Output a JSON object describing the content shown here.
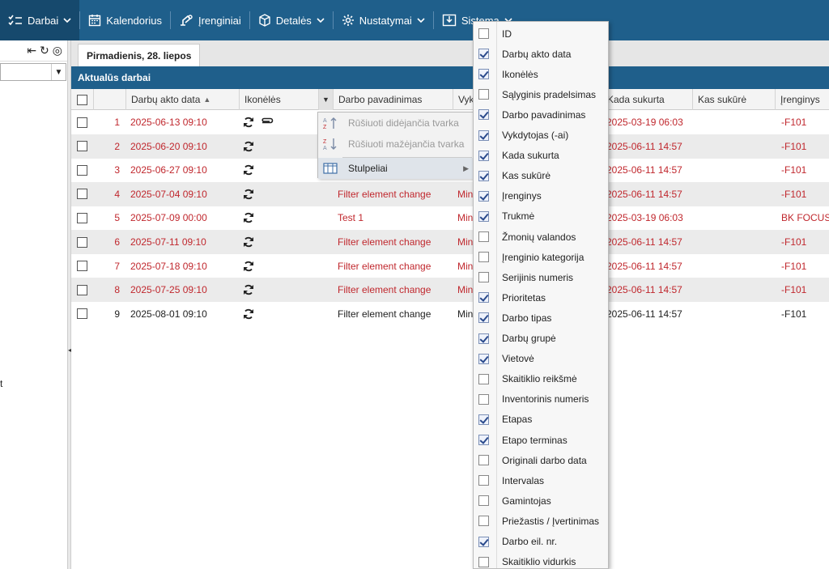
{
  "nav": {
    "items": [
      {
        "label": "Darbai",
        "icon": "checklist-icon",
        "dropdown": true,
        "active": true
      },
      {
        "label": "Kalendorius",
        "icon": "calendar-icon",
        "dropdown": false
      },
      {
        "label": "Įrenginiai",
        "icon": "device-icon",
        "dropdown": false
      },
      {
        "label": "Detalės",
        "icon": "box-icon",
        "dropdown": true
      },
      {
        "label": "Nustatymai",
        "icon": "gear-icon",
        "dropdown": true
      },
      {
        "label": "Sistema",
        "icon": "download-icon",
        "dropdown": true
      }
    ]
  },
  "left_panel": {
    "trailing_text": "t"
  },
  "day_tab": "Pirmadienis, 28. liepos",
  "panel_title": "Aktualūs darbai",
  "columns": [
    "Darbų akto data",
    "Ikonėlės",
    "Darbo pavadinimas",
    "Vyk",
    "Kada sukurta",
    "Kas sukūrė",
    "Įrenginys"
  ],
  "rows": [
    {
      "n": "1",
      "date": "2025-06-13 09:10",
      "icons": [
        "refresh-icon",
        "paperclip-icon"
      ],
      "name": "",
      "vyk": "",
      "created": "2025-03-19 06:03",
      "by": "",
      "device": "-F101",
      "red": true
    },
    {
      "n": "2",
      "date": "2025-06-20 09:10",
      "icons": [
        "refresh-icon"
      ],
      "name": "",
      "vyk": "",
      "created": "2025-06-11 14:57",
      "by": "",
      "device": "-F101",
      "red": true
    },
    {
      "n": "3",
      "date": "2025-06-27 09:10",
      "icons": [
        "refresh-icon"
      ],
      "name": "",
      "vyk": "",
      "created": "2025-06-11 14:57",
      "by": "",
      "device": "-F101",
      "red": true
    },
    {
      "n": "4",
      "date": "2025-07-04 09:10",
      "icons": [
        "refresh-icon"
      ],
      "name": "Filter element change",
      "vyk": "Min",
      "created": "2025-06-11 14:57",
      "by": "",
      "device": "-F101",
      "red": true
    },
    {
      "n": "5",
      "date": "2025-07-09 00:00",
      "icons": [
        "refresh-icon"
      ],
      "name": "Test 1",
      "vyk": "Min",
      "created": "2025-03-19 06:03",
      "by": "",
      "device": "BK FOCUS",
      "red": true
    },
    {
      "n": "6",
      "date": "2025-07-11 09:10",
      "icons": [
        "refresh-icon"
      ],
      "name": "Filter element change",
      "vyk": "Min",
      "created": "2025-06-11 14:57",
      "by": "",
      "device": "-F101",
      "red": true
    },
    {
      "n": "7",
      "date": "2025-07-18 09:10",
      "icons": [
        "refresh-icon"
      ],
      "name": "Filter element change",
      "vyk": "Min",
      "created": "2025-06-11 14:57",
      "by": "",
      "device": "-F101",
      "red": true
    },
    {
      "n": "8",
      "date": "2025-07-25 09:10",
      "icons": [
        "refresh-icon"
      ],
      "name": "Filter element change",
      "vyk": "Min",
      "created": "2025-06-11 14:57",
      "by": "",
      "device": "-F101",
      "red": true
    },
    {
      "n": "9",
      "date": "2025-08-01 09:10",
      "icons": [
        "refresh-icon"
      ],
      "name": "Filter element change",
      "vyk": "Min",
      "created": "2025-06-11 14:57",
      "by": "",
      "device": "-F101",
      "red": false
    }
  ],
  "context_menu": {
    "sort_asc": "Rūšiuoti didėjančia tvarka",
    "sort_desc": "Rūšiuoti mažėjančia tvarka",
    "columns": "Stulpeliai"
  },
  "column_menu": [
    {
      "label": "ID",
      "checked": false
    },
    {
      "label": "Darbų akto data",
      "checked": true
    },
    {
      "label": "Ikonėlės",
      "checked": true
    },
    {
      "label": "Sąlyginis pradelsimas",
      "checked": false
    },
    {
      "label": "Darbo pavadinimas",
      "checked": true
    },
    {
      "label": "Vykdytojas (-ai)",
      "checked": true
    },
    {
      "label": "Kada sukurta",
      "checked": true
    },
    {
      "label": "Kas sukūrė",
      "checked": true
    },
    {
      "label": "Įrenginys",
      "checked": true
    },
    {
      "label": "Trukmė",
      "checked": true
    },
    {
      "label": "Žmonių valandos",
      "checked": false
    },
    {
      "label": "Įrenginio kategorija",
      "checked": false
    },
    {
      "label": "Serijinis numeris",
      "checked": false
    },
    {
      "label": "Prioritetas",
      "checked": true
    },
    {
      "label": "Darbo tipas",
      "checked": true
    },
    {
      "label": "Darbų grupė",
      "checked": true
    },
    {
      "label": "Vietovė",
      "checked": true
    },
    {
      "label": "Skaitiklio reikšmė",
      "checked": false
    },
    {
      "label": "Inventorinis numeris",
      "checked": false
    },
    {
      "label": "Etapas",
      "checked": true
    },
    {
      "label": "Etapo terminas",
      "checked": true
    },
    {
      "label": "Originali darbo data",
      "checked": false
    },
    {
      "label": "Intervalas",
      "checked": false
    },
    {
      "label": "Gamintojas",
      "checked": false
    },
    {
      "label": "Priežastis / Įvertinimas",
      "checked": false
    },
    {
      "label": "Darbo eil. nr.",
      "checked": true
    },
    {
      "label": "Skaitiklio vidurkis",
      "checked": false
    }
  ]
}
